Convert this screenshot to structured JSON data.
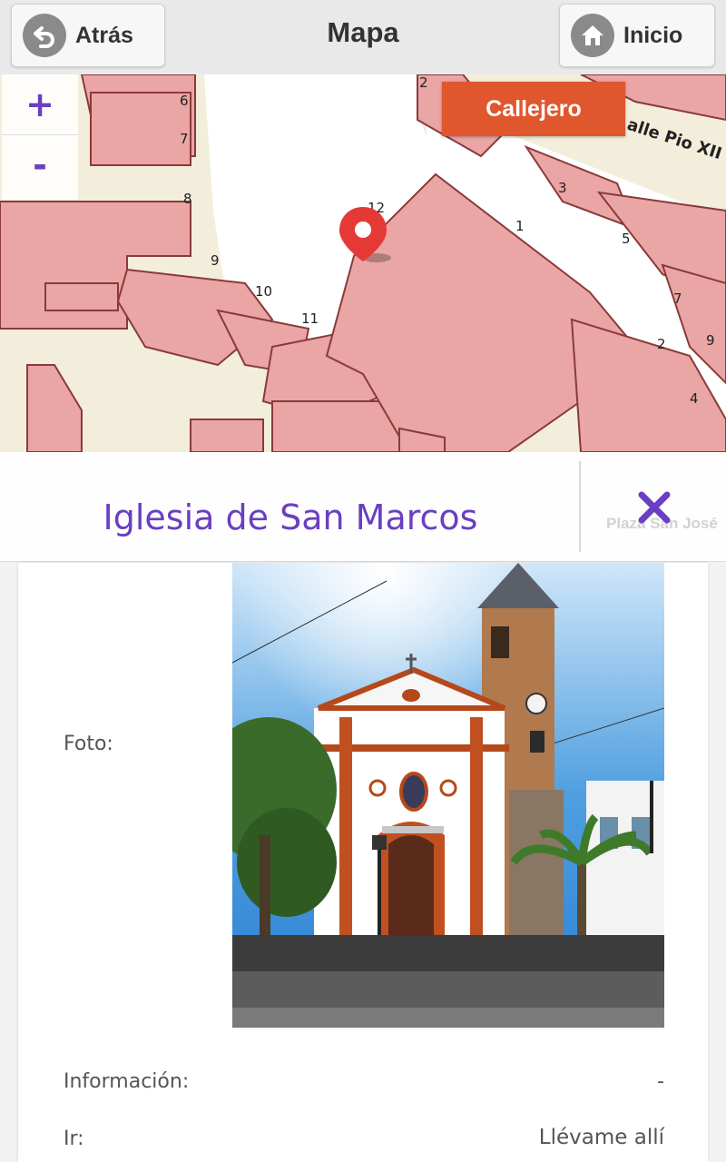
{
  "header": {
    "title": "Mapa",
    "back_label": "Atrás",
    "home_label": "Inicio"
  },
  "map": {
    "zoom_in": "+",
    "zoom_out": "-",
    "street_button": "Callejero",
    "street_labels": [
      "alle Pio XII",
      "Plaza San José"
    ],
    "house_numbers": [
      "2",
      "6",
      "7",
      "8",
      "12",
      "1",
      "3",
      "5",
      "9",
      "10",
      "11",
      "7",
      "2",
      "9",
      "4"
    ]
  },
  "place": {
    "name": "Iglesia de San Marcos",
    "close_icon": "close-icon"
  },
  "details": {
    "photo_label": "Foto:",
    "info_label": "Información:",
    "info_value": "-",
    "go_label": "Ir:",
    "go_value": "Llévame allí"
  },
  "colors": {
    "accent": "#6a3fc1",
    "callejero_bg": "#e0562d",
    "building": "#eaa5a5",
    "marker": "#e53935"
  }
}
